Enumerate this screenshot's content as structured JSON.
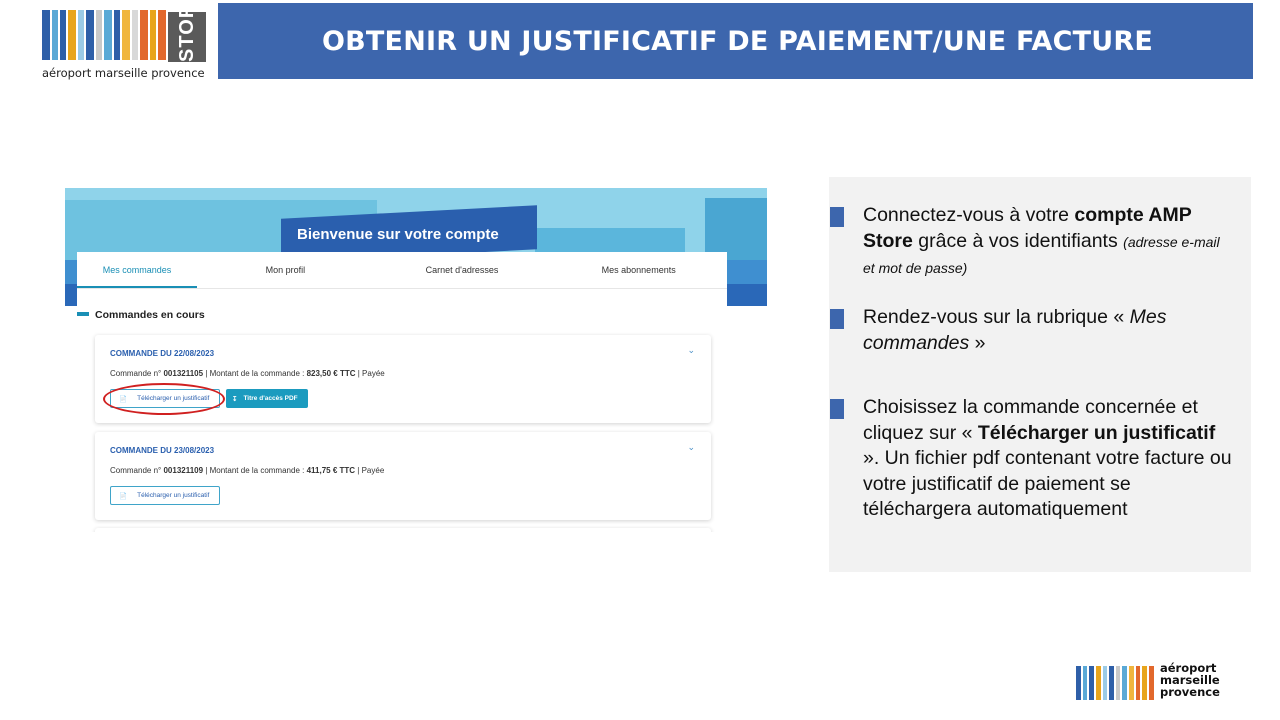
{
  "logo": {
    "store_text": "STORE",
    "caption": "aéroport marseille provence"
  },
  "header": {
    "title": "OBTENIR UN JUSTIFICATIF DE PAIEMENT/UNE FACTURE"
  },
  "screenshot": {
    "welcome": "Bienvenue sur votre compte",
    "tabs": [
      "Mes commandes",
      "Mon profil",
      "Carnet d'adresses",
      "Mes abonnements"
    ],
    "section_title": "Commandes en cours",
    "orders": [
      {
        "title": "COMMANDE DU 22/08/2023",
        "label_num": "Commande n°",
        "num": "001321105",
        "label_amount": "| Montant de la commande :",
        "amount": "823,50 € TTC",
        "status": "| Payée",
        "btn_justif": "Télécharger un justificatif",
        "btn_pdf": "Titre d'accès PDF"
      },
      {
        "title": "COMMANDE DU 23/08/2023",
        "label_num": "Commande n°",
        "num": "001321109",
        "label_amount": "| Montant de la commande :",
        "amount": "411,75 € TTC",
        "status": "| Payée",
        "btn_justif": "Télécharger un justificatif"
      }
    ]
  },
  "steps": [
    {
      "p1": "Connectez-vous à votre ",
      "b1": "compte AMP Store",
      "p2": " grâce à vos identifiants ",
      "small": "(adresse e-mail et mot de passe)"
    },
    {
      "p1": "Rendez-vous sur la rubrique « ",
      "i1": "Mes commandes",
      "p2": " »"
    },
    {
      "p1": "Choisissez la commande  concernée et cliquez sur « ",
      "b1": "Télécharger un justificatif",
      "p2": " ». Un fichier pdf contenant votre facture ou votre justificatif de paiement se téléchargera automatiquement"
    }
  ],
  "logo_bottom": {
    "line1": "aéroport",
    "line2": "marseille",
    "line3": "provence"
  },
  "colors": {
    "header_blue": "#3d66ad",
    "accent_teal": "#1b9bbf",
    "circle_red": "#d02020",
    "panel_gray": "#f2f2f2"
  }
}
